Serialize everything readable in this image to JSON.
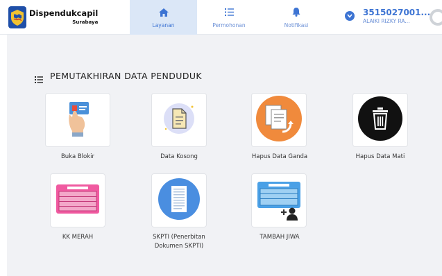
{
  "header": {
    "logo_title": "Dispendukcapil",
    "logo_subtitle": "Surabaya",
    "nav": [
      {
        "label": "Layanan",
        "icon": "home-icon",
        "active": true
      },
      {
        "label": "Permohonan",
        "icon": "list-icon",
        "active": false
      },
      {
        "label": "Notifikasi",
        "icon": "bell-icon",
        "active": false
      }
    ],
    "user": {
      "id": "3515027001...",
      "name": "ALAIKI RIZKY RA..."
    }
  },
  "main": {
    "section_title": "PEMUTAKHIRAN DATA PENDUDUK",
    "services": [
      {
        "label": "Buka Blokir",
        "icon": "hand-card-icon"
      },
      {
        "label": "Data Kosong",
        "icon": "blank-document-icon"
      },
      {
        "label": "Hapus Data Ganda",
        "icon": "duplicate-documents-icon"
      },
      {
        "label": "Hapus Data Mati",
        "icon": "trash-icon"
      },
      {
        "label": "KK MERAH",
        "icon": "red-family-card-icon"
      },
      {
        "label_line1": "SKPTI (Penerbitan",
        "label_line2": "Dokumen SKPTI)",
        "icon": "document-stack-icon"
      },
      {
        "label": "TAMBAH JIWA",
        "icon": "add-person-card-icon"
      }
    ]
  },
  "colors": {
    "accent": "#3d74d3",
    "active_tab_bg": "#dbe7f7",
    "content_bg": "#f1f2f5"
  }
}
